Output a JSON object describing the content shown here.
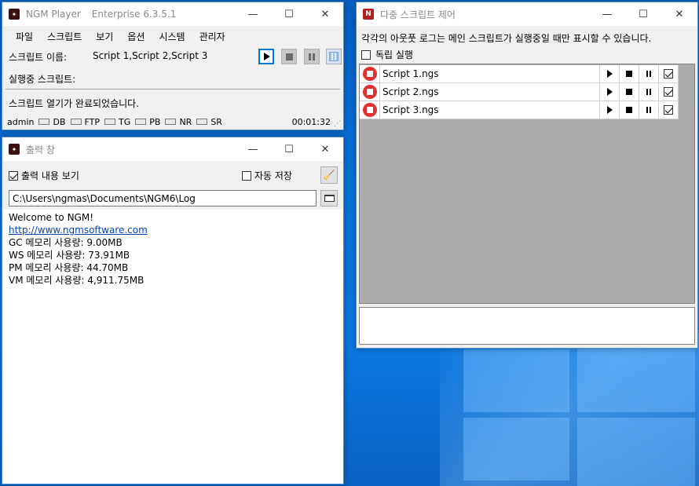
{
  "player": {
    "title_app": "NGM Player",
    "title_edition": "Enterprise 6.3.5.1",
    "menu": [
      "파일",
      "스크립트",
      "보기",
      "옵션",
      "시스템",
      "관리자"
    ],
    "script_name_label": "스크립트 이름:",
    "script_name_value": "Script 1,Script 2,Script 3",
    "running_label": "실행중 스크립트:",
    "message": "스크립트 열기가 완료되었습니다.",
    "status": {
      "user": "admin",
      "indicators": [
        "DB",
        "FTP",
        "TG",
        "PB",
        "NR",
        "SR"
      ],
      "timer": "00:01:32"
    }
  },
  "output": {
    "title": "출력 창",
    "show_output_label": "출력 내용 보기",
    "show_output_checked": true,
    "auto_save_label": "자동 저장",
    "auto_save_checked": false,
    "path": "C:\\Users\\ngmas\\Documents\\NGM6\\Log",
    "lines": [
      "Welcome to NGM!",
      "http://www.ngmsoftware.com",
      "GC 메모리 사용량: 9.00MB",
      "WS 메모리 사용량: 73.91MB",
      "PM 메모리 사용량: 44.70MB",
      "VM 메모리 사용량: 4,911.75MB"
    ]
  },
  "multi": {
    "title": "다중 스크립트 제어",
    "description": "각각의 아웃풋 로그는 메인 스크립트가 실행중일 때만 표시할 수 있습니다.",
    "standalone_label": "독립 실행",
    "standalone_checked": false,
    "scripts": [
      {
        "name": "Script 1.ngs",
        "checked": true
      },
      {
        "name": "Script 2.ngs",
        "checked": true
      },
      {
        "name": "Script 3.ngs",
        "checked": true
      }
    ]
  },
  "colors": {
    "accent_blue": "#0078d7",
    "stop_red": "#e03030",
    "app_icon_dark": "#3a1010",
    "multi_icon": "#b02020"
  }
}
